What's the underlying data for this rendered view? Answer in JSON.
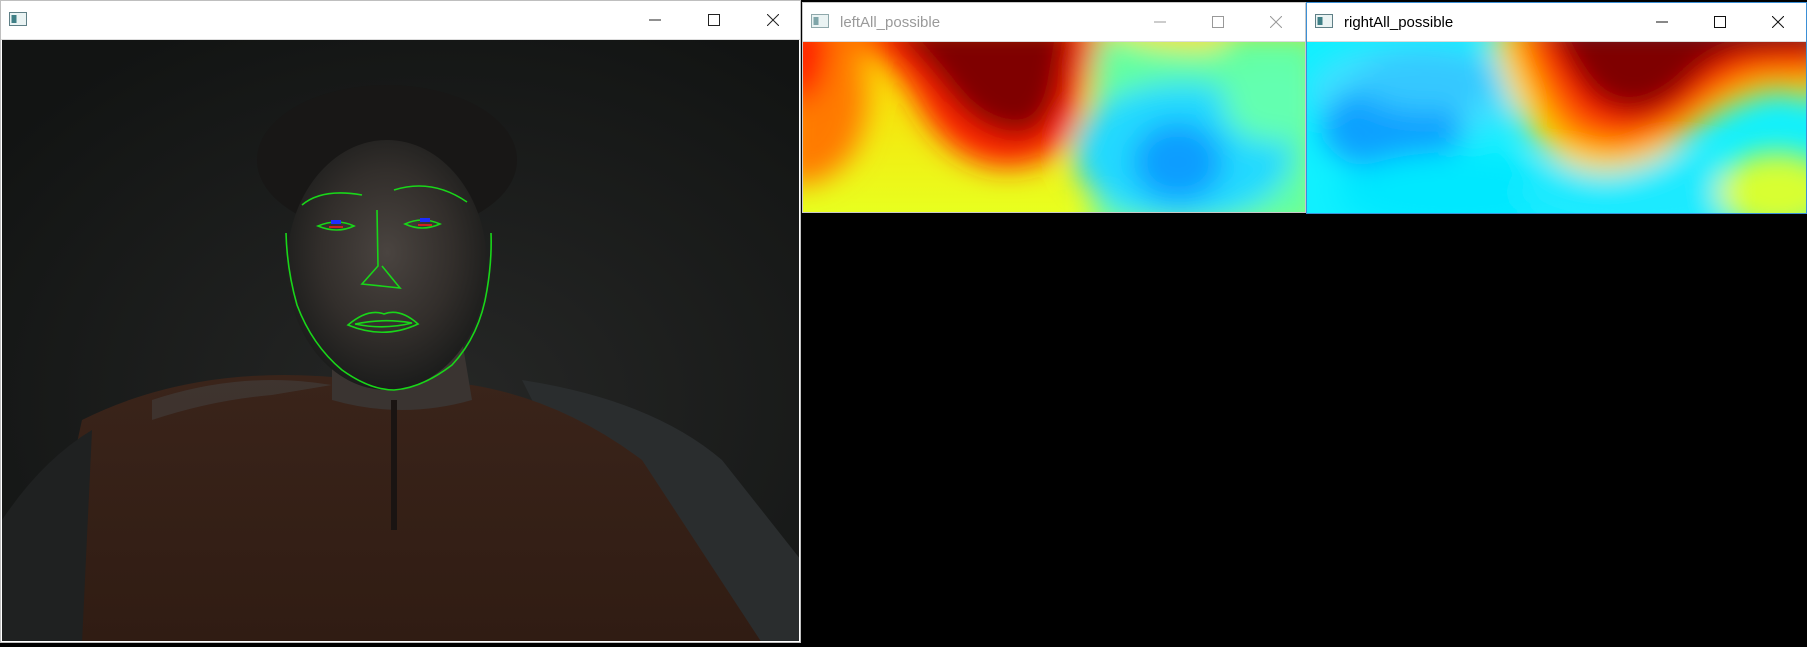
{
  "windows": {
    "camera": {
      "title": "",
      "minimize_icon": "minimize-icon",
      "maximize_icon": "maximize-icon",
      "close_icon": "close-icon"
    },
    "left": {
      "title": "leftAll_possible",
      "active": false
    },
    "right": {
      "title": "rightAll_possible",
      "active": true
    }
  },
  "colors": {
    "landmark_line": "#19d619",
    "pupil_marker_blue": "#1b2cff",
    "pupil_marker_red": "#ff1a1a",
    "heat_max": "#7f0000",
    "heat_min": "#00a6ff"
  }
}
